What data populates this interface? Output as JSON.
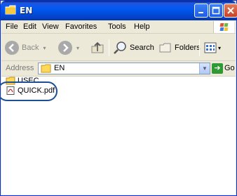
{
  "window": {
    "title": "EN",
    "colors": {
      "titlebar": "#0058ee",
      "chrome": "#ece9d8",
      "content": "#ffffff",
      "highlight_ring": "#1c4f96"
    }
  },
  "menubar": {
    "items": [
      {
        "label": "File"
      },
      {
        "label": "Edit"
      },
      {
        "label": "View"
      },
      {
        "label": "Favorites"
      },
      {
        "label": "Tools"
      },
      {
        "label": "Help"
      }
    ]
  },
  "toolbar": {
    "back_label": "Back",
    "search_label": "Search",
    "folders_label": "Folders",
    "icons": [
      "back-icon",
      "forward-icon",
      "up-folder-icon",
      "search-icon",
      "folders-icon",
      "views-icon"
    ]
  },
  "address": {
    "label": "Address",
    "value": "EN",
    "go_label": "Go"
  },
  "files": [
    {
      "name": "USEC",
      "type": "folder",
      "icon": "folder-icon"
    },
    {
      "name": "QUICK.pdf",
      "type": "pdf",
      "icon": "pdf-file-icon"
    }
  ]
}
